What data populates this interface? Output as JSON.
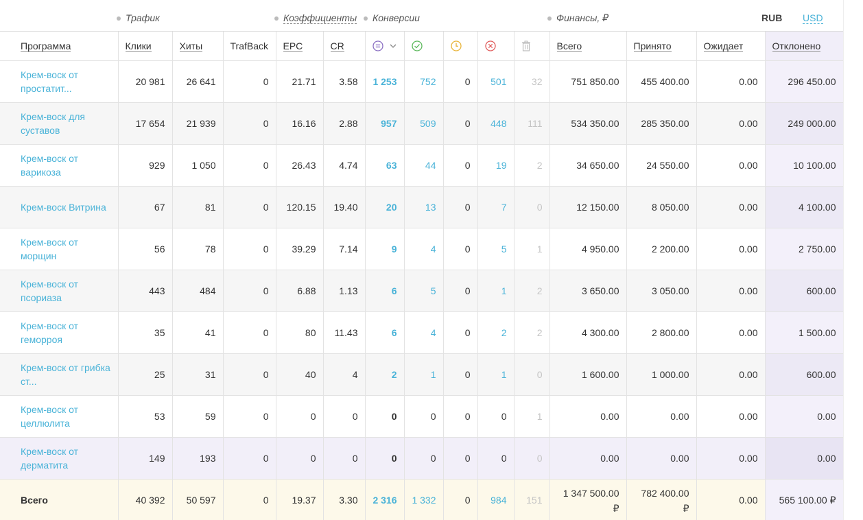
{
  "groups": {
    "traffic": "Трафик",
    "coefficients": "Коэффициенты",
    "conversions": "Конверсии",
    "finance": "Финансы, ₽"
  },
  "currency": {
    "rub": "RUB",
    "usd": "USD",
    "active": "RUB"
  },
  "columns": {
    "program": "Программа",
    "clicks": "Клики",
    "hits": "Хиты",
    "trafback": "TrafBack",
    "epc": "EPC",
    "cr": "CR",
    "conversions_icon": "list-icon",
    "accepted_icon": "check-circle-icon",
    "pending_icon": "clock-icon",
    "rejected_icon": "x-circle-icon",
    "trash_icon": "trash-icon",
    "total": "Всего",
    "accepted": "Принято",
    "pending": "Ожидает",
    "declined": "Отклонено"
  },
  "colors": {
    "link": "#4ab3d8",
    "accepted": "#5cb85c",
    "pending": "#e8b43a",
    "rejected": "#e05a5a",
    "declined_bg": "#f3f0fa",
    "total_bg": "#fdf9ea"
  },
  "rows": [
    {
      "program": "Крем-воск от простатит...",
      "clicks": "20 981",
      "hits": "26 641",
      "trafback": "0",
      "epc": "21.71",
      "cr": "3.58",
      "conv": "1 253",
      "accepted_n": "752",
      "pending_n": "0",
      "rejected_n": "501",
      "trash_n": "32",
      "total": "751 850.00",
      "accepted": "455 400.00",
      "pending": "0.00",
      "declined": "296 450.00"
    },
    {
      "program": "Крем-воск для суставов",
      "clicks": "17 654",
      "hits": "21 939",
      "trafback": "0",
      "epc": "16.16",
      "cr": "2.88",
      "conv": "957",
      "accepted_n": "509",
      "pending_n": "0",
      "rejected_n": "448",
      "trash_n": "111",
      "total": "534 350.00",
      "accepted": "285 350.00",
      "pending": "0.00",
      "declined": "249 000.00"
    },
    {
      "program": "Крем-воск от варикоза",
      "clicks": "929",
      "hits": "1 050",
      "trafback": "0",
      "epc": "26.43",
      "cr": "4.74",
      "conv": "63",
      "accepted_n": "44",
      "pending_n": "0",
      "rejected_n": "19",
      "trash_n": "2",
      "total": "34 650.00",
      "accepted": "24 550.00",
      "pending": "0.00",
      "declined": "10 100.00"
    },
    {
      "program": "Крем-воск Витрина",
      "clicks": "67",
      "hits": "81",
      "trafback": "0",
      "epc": "120.15",
      "cr": "19.40",
      "conv": "20",
      "accepted_n": "13",
      "pending_n": "0",
      "rejected_n": "7",
      "trash_n": "0",
      "total": "12 150.00",
      "accepted": "8 050.00",
      "pending": "0.00",
      "declined": "4 100.00"
    },
    {
      "program": "Крем-воск от морщин",
      "clicks": "56",
      "hits": "78",
      "trafback": "0",
      "epc": "39.29",
      "cr": "7.14",
      "conv": "9",
      "accepted_n": "4",
      "pending_n": "0",
      "rejected_n": "5",
      "trash_n": "1",
      "total": "4 950.00",
      "accepted": "2 200.00",
      "pending": "0.00",
      "declined": "2 750.00"
    },
    {
      "program": "Крем-воск от псориаза",
      "clicks": "443",
      "hits": "484",
      "trafback": "0",
      "epc": "6.88",
      "cr": "1.13",
      "conv": "6",
      "accepted_n": "5",
      "pending_n": "0",
      "rejected_n": "1",
      "trash_n": "2",
      "total": "3 650.00",
      "accepted": "3 050.00",
      "pending": "0.00",
      "declined": "600.00"
    },
    {
      "program": "Крем-воск от геморроя",
      "clicks": "35",
      "hits": "41",
      "trafback": "0",
      "epc": "80",
      "cr": "11.43",
      "conv": "6",
      "accepted_n": "4",
      "pending_n": "0",
      "rejected_n": "2",
      "trash_n": "2",
      "total": "4 300.00",
      "accepted": "2 800.00",
      "pending": "0.00",
      "declined": "1 500.00"
    },
    {
      "program": "Крем-воск от грибка ст...",
      "clicks": "25",
      "hits": "31",
      "trafback": "0",
      "epc": "40",
      "cr": "4",
      "conv": "2",
      "accepted_n": "1",
      "pending_n": "0",
      "rejected_n": "1",
      "trash_n": "0",
      "total": "1 600.00",
      "accepted": "1 000.00",
      "pending": "0.00",
      "declined": "600.00"
    },
    {
      "program": "Крем-воск от целлюлита",
      "clicks": "53",
      "hits": "59",
      "trafback": "0",
      "epc": "0",
      "cr": "0",
      "conv": "0",
      "accepted_n": "0",
      "pending_n": "0",
      "rejected_n": "0",
      "trash_n": "1",
      "total": "0.00",
      "accepted": "0.00",
      "pending": "0.00",
      "declined": "0.00"
    },
    {
      "program": "Крем-воск от дерматита",
      "clicks": "149",
      "hits": "193",
      "trafback": "0",
      "epc": "0",
      "cr": "0",
      "conv": "0",
      "accepted_n": "0",
      "pending_n": "0",
      "rejected_n": "0",
      "trash_n": "0",
      "total": "0.00",
      "accepted": "0.00",
      "pending": "0.00",
      "declined": "0.00"
    }
  ],
  "totals": {
    "label": "Всего",
    "clicks": "40 392",
    "hits": "50 597",
    "trafback": "0",
    "epc": "19.37",
    "cr": "3.30",
    "conv": "2 316",
    "accepted_n": "1 332",
    "pending_n": "0",
    "rejected_n": "984",
    "trash_n": "151",
    "total": "1 347 500.00",
    "accepted": "782 400.00",
    "pending": "0.00",
    "declined": "565 100.00 ₽",
    "currency_sign": "₽"
  }
}
